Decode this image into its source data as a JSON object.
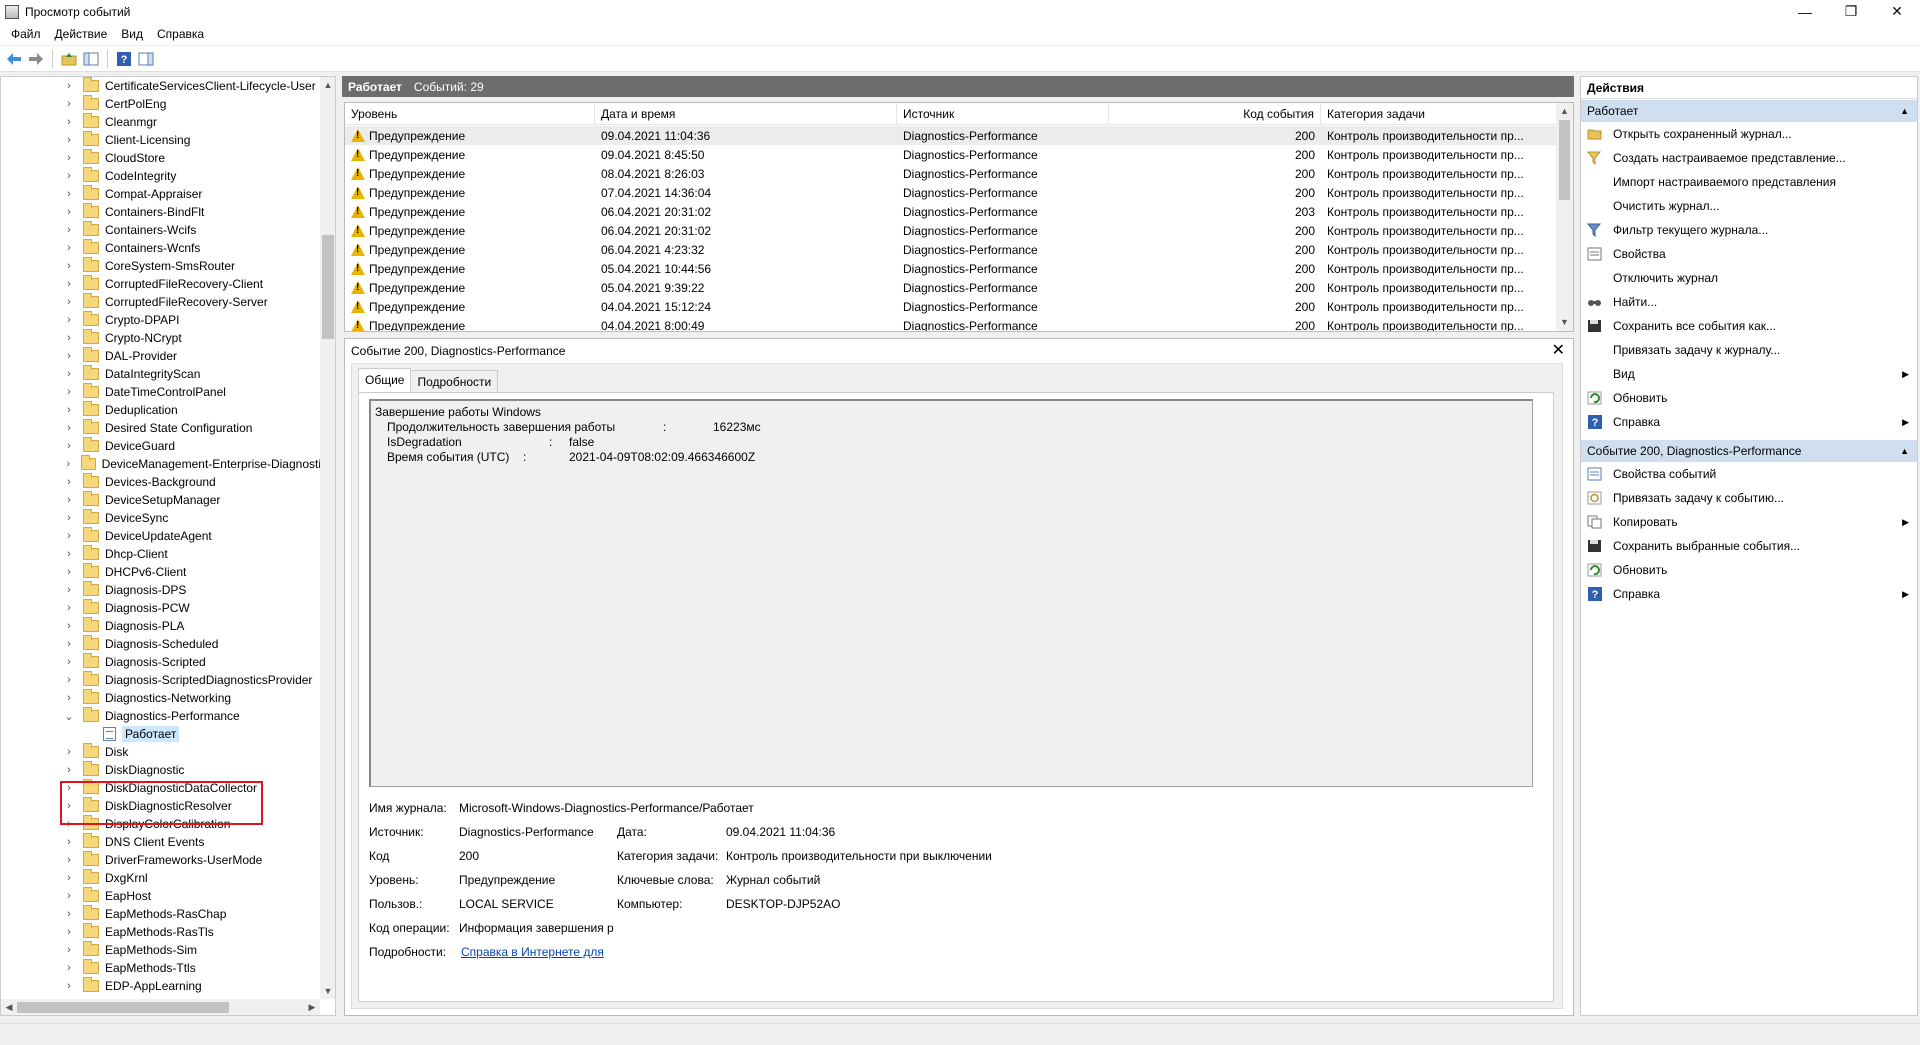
{
  "window": {
    "title": "Просмотр событий",
    "minimize": "—",
    "maximize": "❐",
    "close": "✕"
  },
  "menu": [
    "Файл",
    "Действие",
    "Вид",
    "Справка"
  ],
  "tree": {
    "items": [
      "CertificateServicesClient-Lifecycle-User",
      "CertPolEng",
      "Cleanmgr",
      "Client-Licensing",
      "CloudStore",
      "CodeIntegrity",
      "Compat-Appraiser",
      "Containers-BindFlt",
      "Containers-Wcifs",
      "Containers-Wcnfs",
      "CoreSystem-SmsRouter",
      "CorruptedFileRecovery-Client",
      "CorruptedFileRecovery-Server",
      "Crypto-DPAPI",
      "Crypto-NCrypt",
      "DAL-Provider",
      "DataIntegrityScan",
      "DateTimeControlPanel",
      "Deduplication",
      "Desired State Configuration",
      "DeviceGuard",
      "DeviceManagement-Enterprise-Diagnosti",
      "Devices-Background",
      "DeviceSetupManager",
      "DeviceSync",
      "DeviceUpdateAgent",
      "Dhcp-Client",
      "DHCPv6-Client",
      "Diagnosis-DPS",
      "Diagnosis-PCW",
      "Diagnosis-PLA",
      "Diagnosis-Scheduled",
      "Diagnosis-Scripted",
      "Diagnosis-ScriptedDiagnosticsProvider",
      "Diagnostics-Networking",
      "Diagnostics-Performance"
    ],
    "expanded_child": "Работает",
    "items_after": [
      "Disk",
      "DiskDiagnostic",
      "DiskDiagnosticDataCollector",
      "DiskDiagnosticResolver",
      "DisplayColorCalibration",
      "DNS Client Events",
      "DriverFrameworks-UserMode",
      "DxgKrnl",
      "EapHost",
      "EapMethods-RasChap",
      "EapMethods-RasTls",
      "EapMethods-Sim",
      "EapMethods-Ttls",
      "EDP-AppLearning"
    ]
  },
  "log_header": {
    "name": "Работает",
    "count": "Событий: 29"
  },
  "grid": {
    "columns": [
      "Уровень",
      "Дата и время",
      "Источник",
      "Код события",
      "Категория задачи"
    ],
    "rows": [
      [
        "Предупреждение",
        "09.04.2021 11:04:36",
        "Diagnostics-Performance",
        "200",
        "Контроль производительности пр..."
      ],
      [
        "Предупреждение",
        "09.04.2021 8:45:50",
        "Diagnostics-Performance",
        "200",
        "Контроль производительности пр..."
      ],
      [
        "Предупреждение",
        "08.04.2021 8:26:03",
        "Diagnostics-Performance",
        "200",
        "Контроль производительности пр..."
      ],
      [
        "Предупреждение",
        "07.04.2021 14:36:04",
        "Diagnostics-Performance",
        "200",
        "Контроль производительности пр..."
      ],
      [
        "Предупреждение",
        "06.04.2021 20:31:02",
        "Diagnostics-Performance",
        "203",
        "Контроль производительности пр..."
      ],
      [
        "Предупреждение",
        "06.04.2021 20:31:02",
        "Diagnostics-Performance",
        "200",
        "Контроль производительности пр..."
      ],
      [
        "Предупреждение",
        "06.04.2021 4:23:32",
        "Diagnostics-Performance",
        "200",
        "Контроль производительности пр..."
      ],
      [
        "Предупреждение",
        "05.04.2021 10:44:56",
        "Diagnostics-Performance",
        "200",
        "Контроль производительности пр..."
      ],
      [
        "Предупреждение",
        "05.04.2021 9:39:22",
        "Diagnostics-Performance",
        "200",
        "Контроль производительности пр..."
      ],
      [
        "Предупреждение",
        "04.04.2021 15:12:24",
        "Diagnostics-Performance",
        "200",
        "Контроль производительности пр..."
      ],
      [
        "Предупреждение",
        "04.04.2021 8:00:49",
        "Diagnostics-Performance",
        "200",
        "Контроль производительности пр..."
      ]
    ]
  },
  "detail": {
    "title": "Событие 200, Diagnostics-Performance",
    "close": "✕",
    "tabs": [
      "Общие",
      "Подробности"
    ],
    "description": {
      "heading": "Завершение работы Windows",
      "lines": [
        {
          "key": "Продолжительность завершения работы",
          "sep": ":",
          "value": "16223мс"
        },
        {
          "key": "IsDegradation",
          "sep": ":",
          "value": "false"
        },
        {
          "key": "Время события (UTC)",
          "sep": ":",
          "value": "2021-04-09T08:02:09.466346600Z"
        }
      ]
    },
    "props": {
      "log_name_label": "Имя журнала:",
      "log_name": "Microsoft-Windows-Diagnostics-Performance/Работает",
      "source_label": "Источник:",
      "source": "Diagnostics-Performance",
      "date_label": "Дата:",
      "date": "09.04.2021 11:04:36",
      "code_label": "Код",
      "code": "200",
      "task_label": "Категория задачи:",
      "task": "Контроль производительности при выключении",
      "level_label": "Уровень:",
      "level": "Предупреждение",
      "keywords_label": "Ключевые слова:",
      "keywords": "Журнал событий",
      "user_label": "Пользов.:",
      "user": "LOCAL SERVICE",
      "computer_label": "Компьютер:",
      "computer": "DESKTOP-DJP52AO",
      "opcode_label": "Код операции:",
      "opcode": "Информация завершения р",
      "details_label": "Подробности:",
      "details_link": "Справка в Интернете для"
    }
  },
  "actions": {
    "title": "Действия",
    "section1": "Работает",
    "items1": [
      {
        "label": "Открыть сохраненный журнал...",
        "icon": "open-folder-icon"
      },
      {
        "label": "Создать настраиваемое представление...",
        "icon": "filter-add-icon"
      },
      {
        "label": "Импорт настраиваемого представления",
        "icon": ""
      },
      {
        "label": "Очистить журнал...",
        "icon": ""
      },
      {
        "label": "Фильтр текущего журнала...",
        "icon": "filter-icon"
      },
      {
        "label": "Свойства",
        "icon": "properties-icon"
      },
      {
        "label": "Отключить журнал",
        "icon": ""
      },
      {
        "label": "Найти...",
        "icon": "find-icon"
      },
      {
        "label": "Сохранить все события как...",
        "icon": "save-icon"
      },
      {
        "label": "Привязать задачу к журналу...",
        "icon": ""
      },
      {
        "label": "Вид",
        "icon": "",
        "submenu": true
      },
      {
        "label": "Обновить",
        "icon": "refresh-icon"
      },
      {
        "label": "Справка",
        "icon": "help-icon",
        "submenu": true
      }
    ],
    "section2": "Событие 200, Diagnostics-Performance",
    "items2": [
      {
        "label": "Свойства событий",
        "icon": "event-properties-icon"
      },
      {
        "label": "Привязать задачу к событию...",
        "icon": "task-icon"
      },
      {
        "label": "Копировать",
        "icon": "copy-icon",
        "submenu": true
      },
      {
        "label": "Сохранить выбранные события...",
        "icon": "save-icon"
      },
      {
        "label": "Обновить",
        "icon": "refresh-icon"
      },
      {
        "label": "Справка",
        "icon": "help-icon",
        "submenu": true
      }
    ]
  }
}
